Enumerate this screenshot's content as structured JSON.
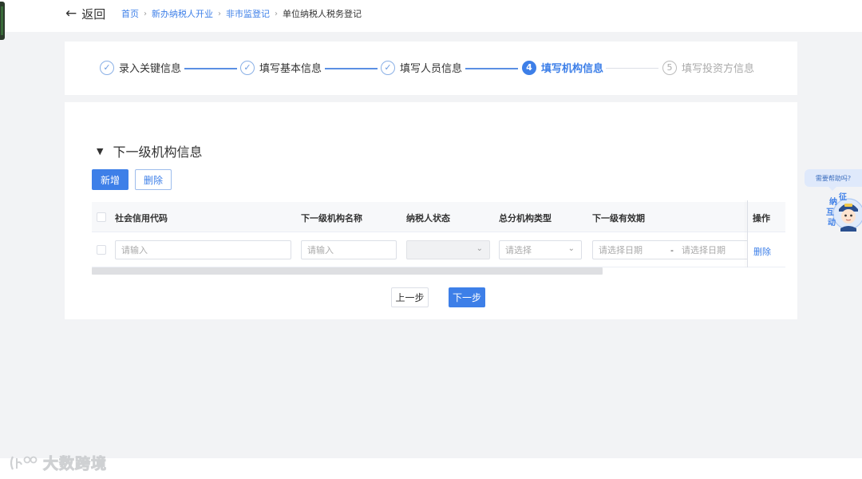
{
  "header": {
    "back_label": "返回",
    "breadcrumb": [
      "首页",
      "新办纳税人开业",
      "非市监登记"
    ],
    "breadcrumb_current": "单位纳税人税务登记"
  },
  "steps": [
    {
      "num": "✓",
      "label": "录入关键信息",
      "state": "done"
    },
    {
      "num": "✓",
      "label": "填写基本信息",
      "state": "done"
    },
    {
      "num": "✓",
      "label": "填写人员信息",
      "state": "done"
    },
    {
      "num": "4",
      "label": "填写机构信息",
      "state": "active"
    },
    {
      "num": "5",
      "label": "填写投资方信息",
      "state": "todo"
    }
  ],
  "section": {
    "title": "下一级机构信息",
    "add_label": "新增",
    "delete_label": "删除"
  },
  "table": {
    "columns": [
      "社会信用代码",
      "下一级机构名称",
      "纳税人状态",
      "总分机构类型",
      "下一级有效期",
      "操作"
    ],
    "row": {
      "credit_code_placeholder": "请输入",
      "name_placeholder": "请输入",
      "type_placeholder": "请选择",
      "date_start_placeholder": "请选择日期",
      "date_sep": "-",
      "date_end_placeholder": "请选择日期",
      "action_label": "删除"
    }
  },
  "footer": {
    "prev_label": "上一步",
    "next_label": "下一步"
  },
  "help": {
    "bubble_text": "需要帮助吗?",
    "mascot_letters": [
      "征",
      "纳",
      "互",
      "动"
    ]
  },
  "watermark": {
    "text": "大数跨境"
  },
  "colors": {
    "accent": "#3d7fe8",
    "page_bg": "#f2f3f5"
  }
}
